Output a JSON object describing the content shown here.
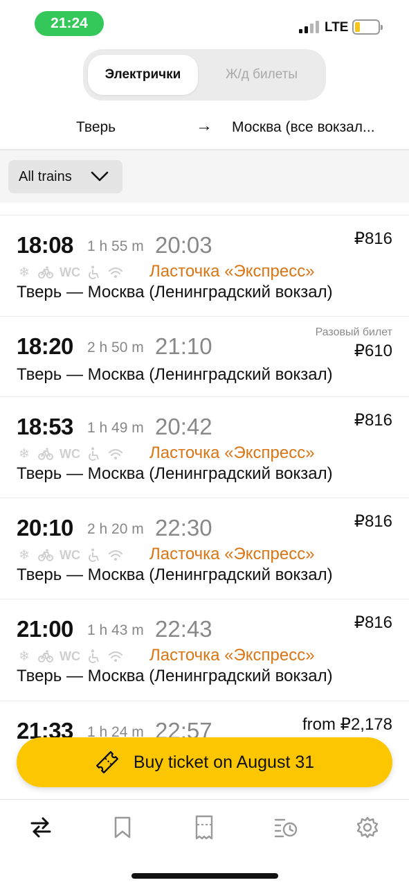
{
  "status": {
    "time": "21:24",
    "network": "LTE",
    "battery_color": "#f5c518",
    "pill_color": "#34c759"
  },
  "segments": {
    "active": "Электрички",
    "inactive": "Ж/д билеты"
  },
  "route": {
    "from": "Тверь",
    "arrow": "→",
    "to": "Москва (все вокзал..."
  },
  "filter": {
    "label": "All trains",
    "icon": "chevron-down-icon"
  },
  "trains": [
    {
      "dep": "18:08",
      "dur": "1 h 55 m",
      "arr": "20:03",
      "price": "₽816",
      "note": "",
      "brand": "Ласточка «Экспресс»",
      "route": "Тверь — Москва (Ленинградский вокзал)"
    },
    {
      "dep": "18:20",
      "dur": "2 h 50 m",
      "arr": "21:10",
      "price": "₽610",
      "note": "Разовый билет",
      "brand": "",
      "route": "Тверь — Москва (Ленинградский вокзал)"
    },
    {
      "dep": "18:53",
      "dur": "1 h 49 m",
      "arr": "20:42",
      "price": "₽816",
      "note": "",
      "brand": "Ласточка «Экспресс»",
      "route": "Тверь — Москва (Ленинградский вокзал)"
    },
    {
      "dep": "20:10",
      "dur": "2 h 20 m",
      "arr": "22:30",
      "price": "₽816",
      "note": "",
      "brand": "Ласточка «Экспресс»",
      "route": "Тверь — Москва (Ленинградский вокзал)"
    },
    {
      "dep": "21:00",
      "dur": "1 h 43 m",
      "arr": "22:43",
      "price": "₽816",
      "note": "",
      "brand": "Ласточка «Экспресс»",
      "route": "Тверь — Москва (Ленинградский вокзал)"
    },
    {
      "dep": "21:33",
      "dur": "1 h 24 m",
      "arr": "22:57",
      "price": "from ₽2,178",
      "note": "",
      "brand": "",
      "route": ""
    }
  ],
  "amenities": {
    "climate": "snowflake-icon",
    "bike": "bicycle-icon",
    "toilet": "WC",
    "accessible": "wheelchair-icon",
    "wifi": "wifi-icon"
  },
  "buy_button": {
    "label": "Buy ticket on August 31",
    "icon": "ticket-icon",
    "color": "#fcc700"
  },
  "tabbar": {
    "items": [
      "routes-icon",
      "bookmark-icon",
      "ticket-icon",
      "history-icon",
      "settings-icon"
    ]
  },
  "colors": {
    "brand_orange": "#d97514",
    "muted": "#888888"
  }
}
